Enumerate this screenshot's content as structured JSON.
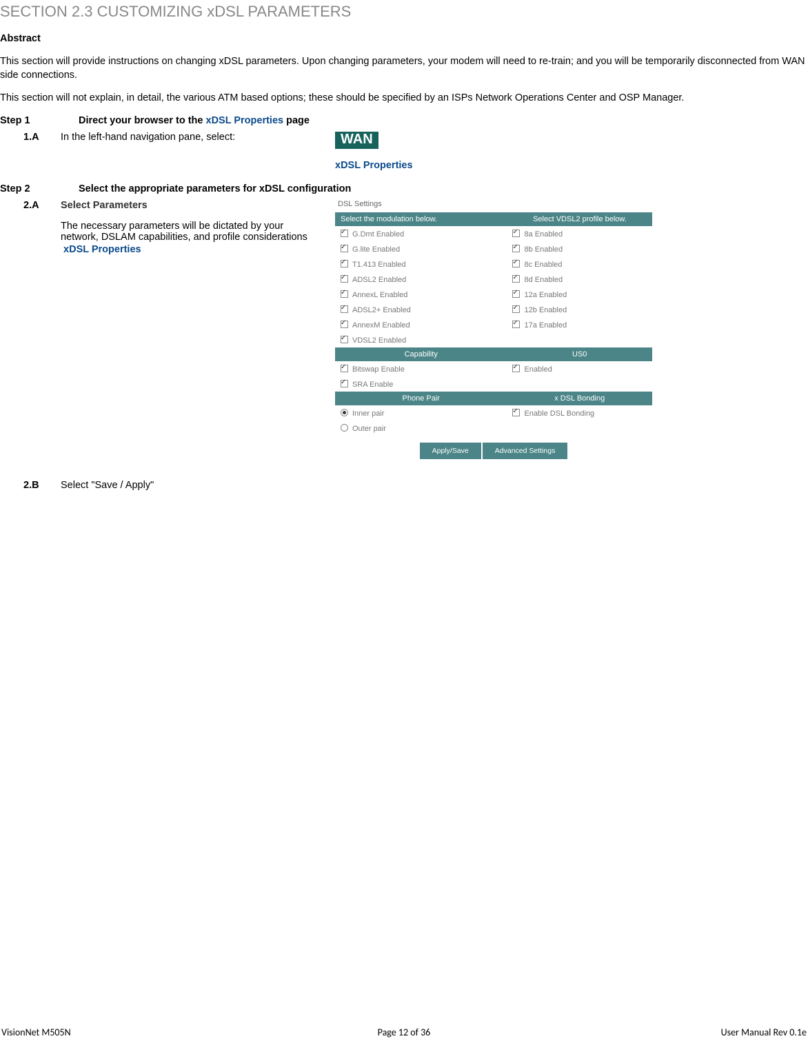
{
  "section_title": "SECTION 2.3   CUSTOMIZING xDSL PARAMETERS",
  "abstract_label": "Abstract",
  "para1": "This section will provide instructions on changing xDSL parameters. Upon changing parameters, your modem will need to re-train; and you will be temporarily disconnected from WAN side connections.",
  "para2": "This section will not explain, in detail, the various ATM based options; these should be specified by an ISPs Network Operations Center and OSP Manager.",
  "step1": {
    "label": "Step 1",
    "text_prefix": "Direct your browser to the ",
    "text_link": "xDSL Properties",
    "text_suffix": " page",
    "sub": {
      "label": "1.A",
      "text": "In the left-hand navigation pane, select:",
      "badge": "WAN",
      "link": "xDSL Properties"
    }
  },
  "step2": {
    "label": "Step 2",
    "text": "Select the appropriate parameters for xDSL configuration",
    "subA": {
      "label": "2.A",
      "title": "Select Parameters",
      "body": "The necessary parameters will be dictated by your network, DSLAM capabilities, and profile considerations",
      "link": "xDSL Properties"
    },
    "subB": {
      "label": "2.B",
      "text": "Select \"Save / Apply\""
    }
  },
  "dsl": {
    "title": "DSL Settings",
    "hdr_left": "Select the modulation below.",
    "hdr_right": "Select VDSL2 profile below.",
    "mod": [
      "G.Dmt Enabled",
      "G.lite Enabled",
      "T1.413 Enabled",
      "ADSL2 Enabled",
      "AnnexL Enabled",
      "ADSL2+ Enabled",
      "AnnexM Enabled",
      "VDSL2 Enabled"
    ],
    "prof": [
      "8a Enabled",
      "8b Enabled",
      "8c Enabled",
      "8d Enabled",
      "12a Enabled",
      "12b Enabled",
      "17a Enabled"
    ],
    "cap_hdr_left": "Capability",
    "cap_hdr_right": "US0",
    "cap_left": [
      "Bitswap Enable",
      "SRA Enable"
    ],
    "cap_right": "Enabled",
    "pp_hdr_left": "Phone Pair",
    "pp_hdr_right": "x DSL Bonding",
    "pp_inner": "Inner pair",
    "pp_outer": "Outer pair",
    "pp_bond": "Enable DSL Bonding",
    "btn1": "Apply/Save",
    "btn2": "Advanced Settings"
  },
  "footer": {
    "left": "VisionNet   M505N",
    "center": "Page 12 of 36",
    "right": "User Manual Rev 0.1e"
  }
}
